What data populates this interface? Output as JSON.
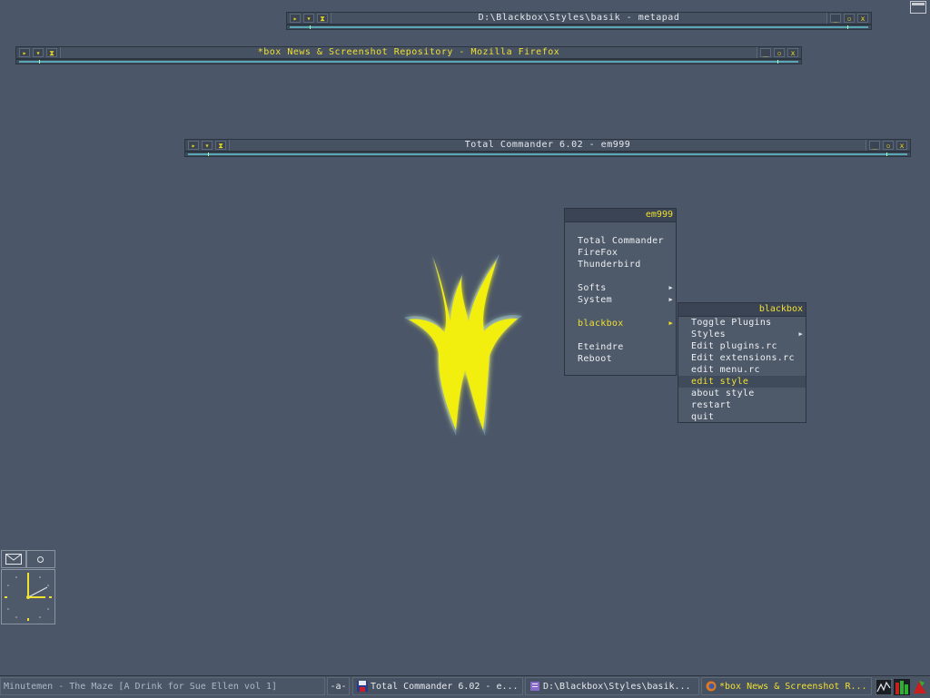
{
  "windows": {
    "metapad": {
      "title": "D:\\Blackbox\\Styles\\basik - metapad"
    },
    "firefox": {
      "title": "*box News & Screenshot Repository - Mozilla Firefox"
    },
    "totalcmd": {
      "title": "Total Commander 6.02 - em999"
    }
  },
  "titlebar_buttons": {
    "left": [
      "▶",
      "▼",
      "⧗"
    ],
    "right": [
      "_",
      "▫",
      "x"
    ]
  },
  "main_menu": {
    "title": "em999",
    "items": [
      "Total Commander",
      "FireFox",
      "Thunderbird",
      "",
      "Softs",
      "System",
      "",
      "blackbox",
      "",
      "Eteindre",
      "Reboot"
    ]
  },
  "sub_menu": {
    "title": "blackbox",
    "items": [
      "Toggle Plugins",
      "Styles",
      "Edit plugins.rc",
      "Edit extensions.rc",
      "edit menu.rc",
      "edit style",
      "about style",
      "restart",
      "quit"
    ]
  },
  "taskbar": {
    "now_playing": "Minutemen - The Maze [A Drink for Sue Ellen vol 1]",
    "workspace": "-a-",
    "tasks": [
      "Total Commander 6.02 - e...",
      "D:\\Blackbox\\Styles\\basik...",
      "*box News & Screenshot R..."
    ]
  },
  "colors": {
    "accent": "#f0e030",
    "desktop": "#4b5668",
    "handle": "#5aa6b4"
  }
}
